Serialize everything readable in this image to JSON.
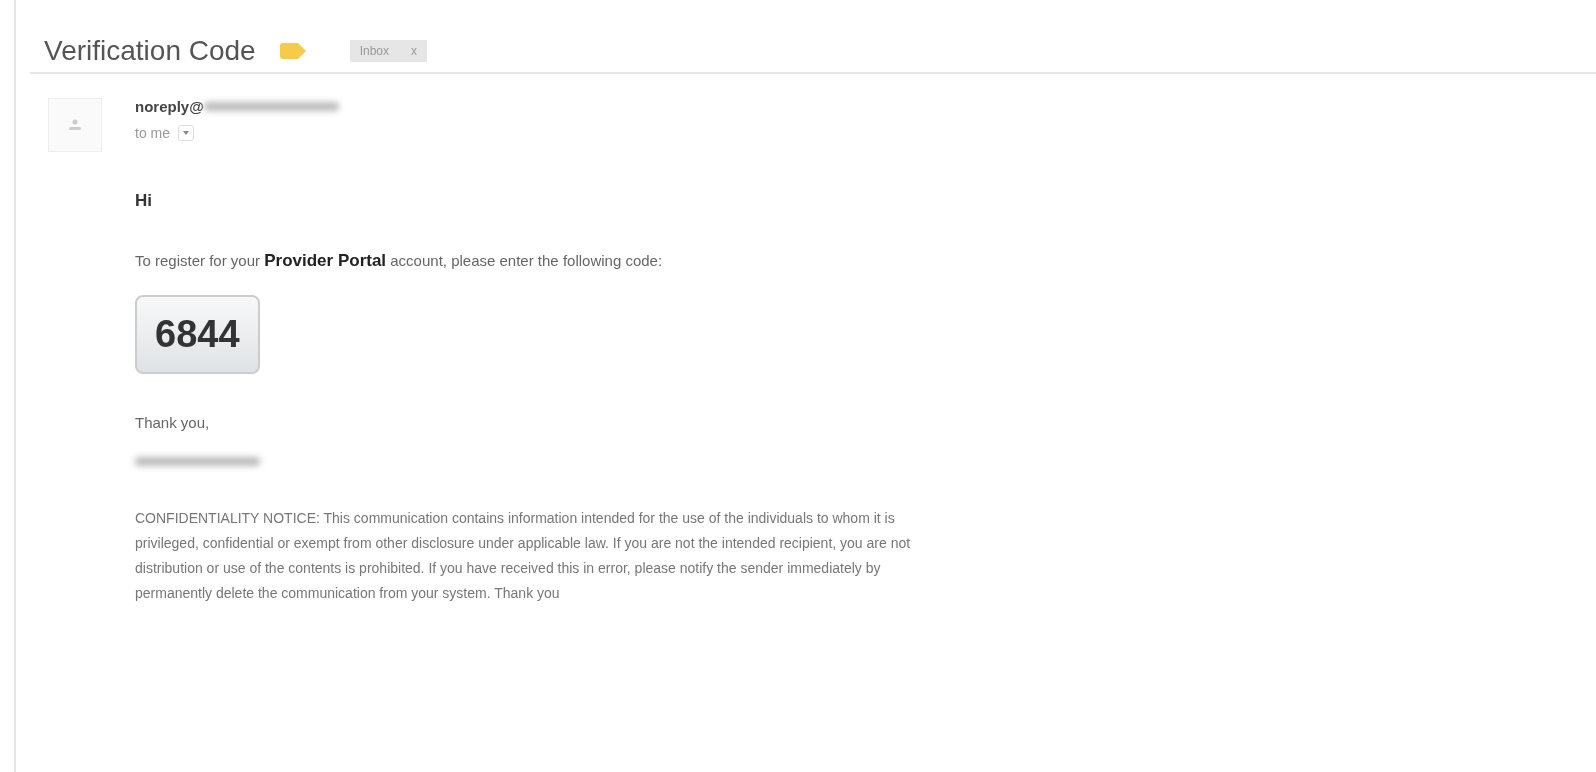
{
  "subject": "Verification Code",
  "label_chip": {
    "text": "Inbox",
    "close": "x"
  },
  "sender": {
    "address_start": "noreply@",
    "recipient": "to me"
  },
  "body": {
    "greeting": "Hi",
    "intro": "To register for your **Provider Portal** account, please enter the following code:",
    "code": "6844",
    "closing": "Thank you,",
    "notice_lines": [
      "CONFIDENTIALITY NOTICE: This communication contains information intended for the use of the individuals to whom it is",
      "privileged, confidential or exempt from other disclosure under applicable law. If you are not the intended recipient, you are not",
      "distribution or use of the contents is prohibited. If you have received this in error, please notify the sender immediately by",
      "permanently delete the communication from your system. Thank you"
    ]
  }
}
